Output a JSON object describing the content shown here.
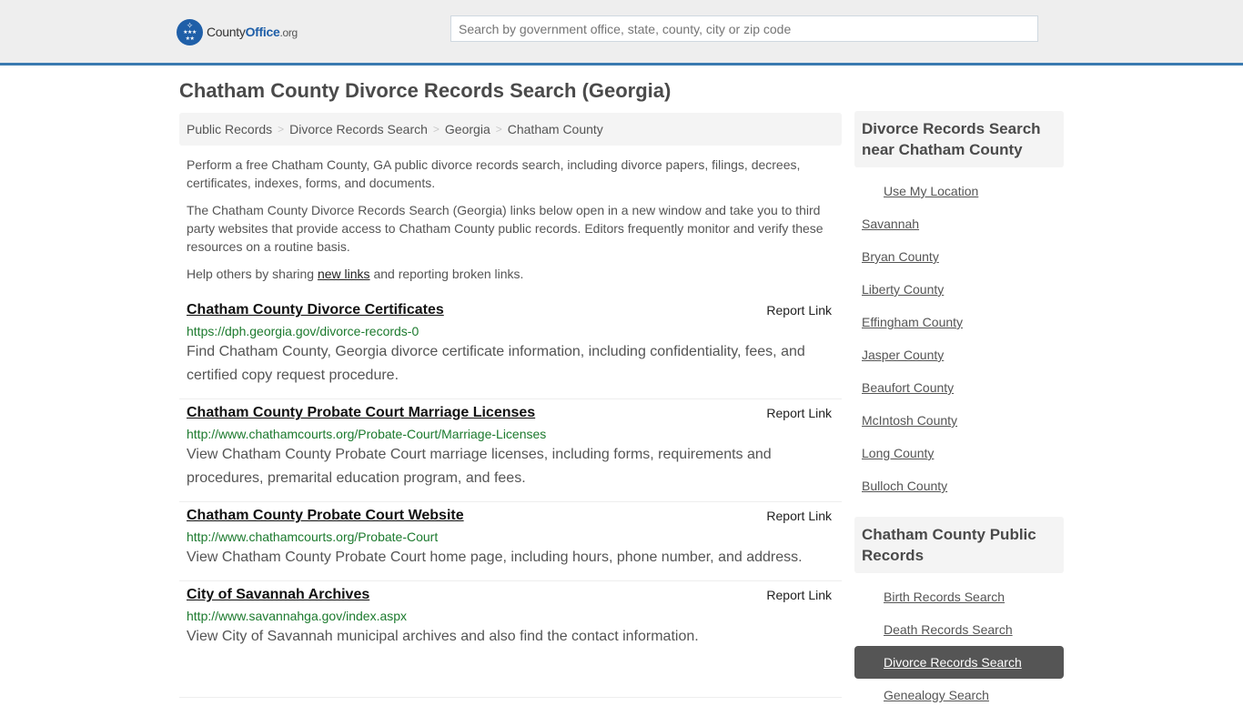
{
  "header": {
    "logo": {
      "name_main": "County",
      "name_accent": "Office",
      "name_suffix": ".org",
      "icon": "eagle-stars-badge"
    },
    "search": {
      "placeholder": "Search by government office, state, county, city or zip code",
      "value": ""
    },
    "accent_color": "#3a7ab0"
  },
  "page": {
    "title": "Chatham County Divorce Records Search (Georgia)"
  },
  "breadcrumb": [
    {
      "label": "Public Records"
    },
    {
      "label": "Divorce Records Search"
    },
    {
      "label": "Georgia"
    },
    {
      "label": "Chatham County"
    }
  ],
  "breadcrumb_separator": ">",
  "intro": {
    "p1": "Perform a free Chatham County, GA public divorce records search, including divorce papers, filings, decrees, certificates, indexes, forms, and documents.",
    "p2": "The Chatham County Divorce Records Search (Georgia) links below open in a new window and take you to third party websites that provide access to Chatham County public records. Editors frequently monitor and verify these resources on a routine basis.",
    "p3_before": "Help others by sharing ",
    "p3_link": "new links",
    "p3_after": " and reporting broken links."
  },
  "results": [
    {
      "title": "Chatham County Divorce Certificates",
      "url": "https://dph.georgia.gov/divorce-records-0",
      "description": "Find Chatham County, Georgia divorce certificate information, including confidentiality, fees, and certified copy request procedure.",
      "report_label": "Report Link"
    },
    {
      "title": "Chatham County Probate Court Marriage Licenses",
      "url": "http://www.chathamcourts.org/Probate-Court/Marriage-Licenses",
      "description": "View Chatham County Probate Court marriage licenses, including forms, requirements and procedures, premarital education program, and fees.",
      "report_label": "Report Link"
    },
    {
      "title": "Chatham County Probate Court Website",
      "url": "http://www.chathamcourts.org/Probate-Court",
      "description": "View Chatham County Probate Court home page, including hours, phone number, and address.",
      "report_label": "Report Link"
    },
    {
      "title": "City of Savannah Archives",
      "url": "http://www.savannahga.gov/index.aspx",
      "description": "View City of Savannah municipal archives and also find the contact information.",
      "report_label": "Report Link"
    }
  ],
  "sidebar": {
    "nearby": {
      "heading": "Divorce Records Search near Chatham County",
      "use_location": "Use My Location",
      "items": [
        "Savannah",
        "Bryan County",
        "Liberty County",
        "Effingham County",
        "Jasper County",
        "Beaufort County",
        "McIntosh County",
        "Long County",
        "Bulloch County"
      ]
    },
    "public_records": {
      "heading": "Chatham County Public Records",
      "items": [
        {
          "label": "Birth Records Search",
          "active": false
        },
        {
          "label": "Death Records Search",
          "active": false
        },
        {
          "label": "Divorce Records Search",
          "active": true
        },
        {
          "label": "Genealogy Search",
          "active": false
        }
      ]
    }
  }
}
